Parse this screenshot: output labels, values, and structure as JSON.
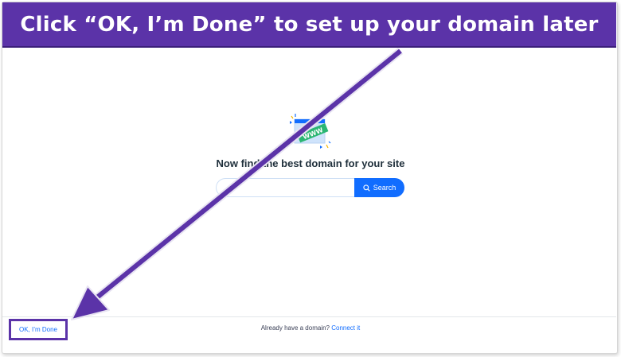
{
  "banner": {
    "text": "Click “OK, I’m Done” to set up your domain later"
  },
  "illustration": {
    "badge_text": "WWW"
  },
  "main": {
    "heading": "Now find the best domain for your site",
    "search": {
      "value": "",
      "placeholder": "",
      "button_label": "Search"
    }
  },
  "footer": {
    "ok_done_label": "OK, I’m Done",
    "already_text": "Already have a domain?",
    "connect_label": "Connect it"
  },
  "colors": {
    "brand_purple": "#5b33a8",
    "link_blue": "#116dff",
    "badge_green": "#2bb673"
  },
  "icons": {
    "search_button_icon": "search-icon",
    "illustration": "domain-www-icon",
    "annotation": "arrow-icon"
  }
}
